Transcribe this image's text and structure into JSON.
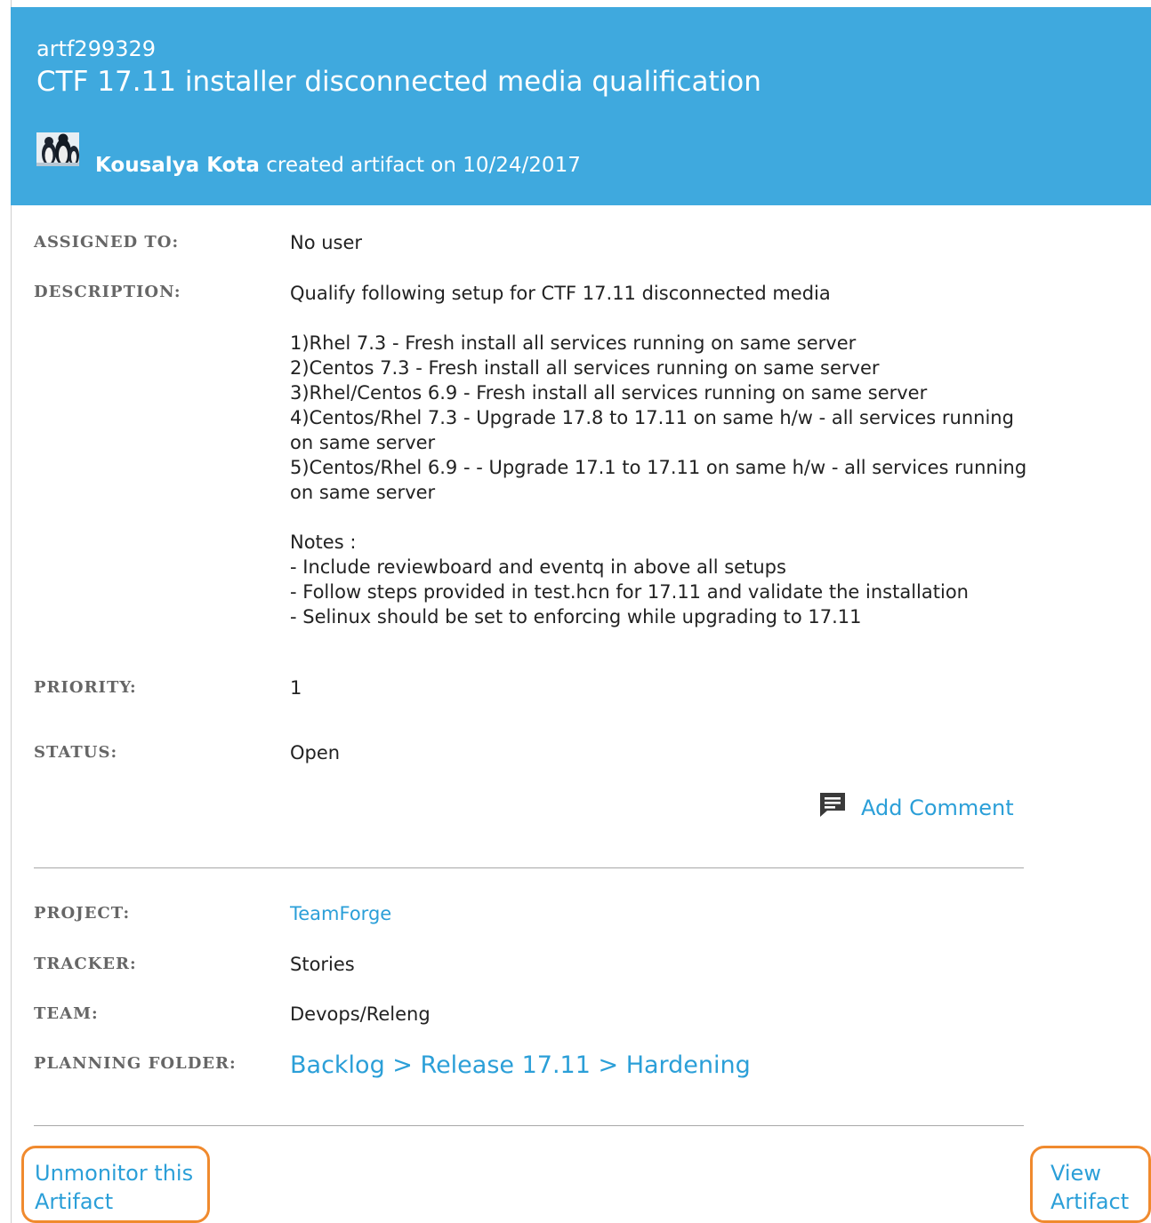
{
  "header": {
    "artifact_id": "artf299329",
    "title": "CTF 17.11 installer disconnected media qualification",
    "creator": "Kousalya Kota",
    "created_text": " created artifact on 10/24/2017",
    "avatar_icon": "penguins-avatar-icon",
    "background_color": "#3fa9de"
  },
  "fields": {
    "assigned_to": {
      "label": "ASSIGNED TO:",
      "value": "No user"
    },
    "description": {
      "label": "DESCRIPTION:",
      "intro": "Qualify following setup for CTF 17.11 disconnected media",
      "items": [
        "1)Rhel 7.3 - Fresh install all services running on same server",
        "2)Centos 7.3 - Fresh install all services running on same server",
        "3)Rhel/Centos 6.9  - Fresh install all services running on same server",
        "4)Centos/Rhel 7.3 - Upgrade 17.8 to 17.11 on same h/w - all services running on same server",
        "5)Centos/Rhel 6.9 - - Upgrade 17.1 to 17.11 on same h/w - all services running on same server"
      ],
      "notes_title": "Notes :",
      "notes": [
        "- Include reviewboard and eventq in above all setups",
        "- Follow steps provided in test.hcn for 17.11 and validate the installation",
        "- Selinux should be set to enforcing while upgrading to 17.11"
      ]
    },
    "priority": {
      "label": "PRIORITY:",
      "value": "1"
    },
    "status": {
      "label": "STATUS:",
      "value": "Open"
    }
  },
  "actions": {
    "add_comment": "Add Comment",
    "add_comment_icon": "comment-icon"
  },
  "details": {
    "project": {
      "label": "PROJECT:",
      "value": "TeamForge"
    },
    "tracker": {
      "label": "TRACKER:",
      "value": "Stories"
    },
    "team": {
      "label": "TEAM:",
      "value": "Devops/Releng"
    },
    "planning_folder": {
      "label": "PLANNING FOLDER:",
      "path": [
        "Backlog",
        "Release 17.11",
        "Hardening"
      ],
      "separator": " > "
    }
  },
  "footer": {
    "unmonitor_line1": "Unmonitor this",
    "unmonitor_line2": "Artifact",
    "view_line1": "View",
    "view_line2": "Artifact",
    "highlight_color": "#f08a2e",
    "link_color": "#2b9fd8"
  }
}
